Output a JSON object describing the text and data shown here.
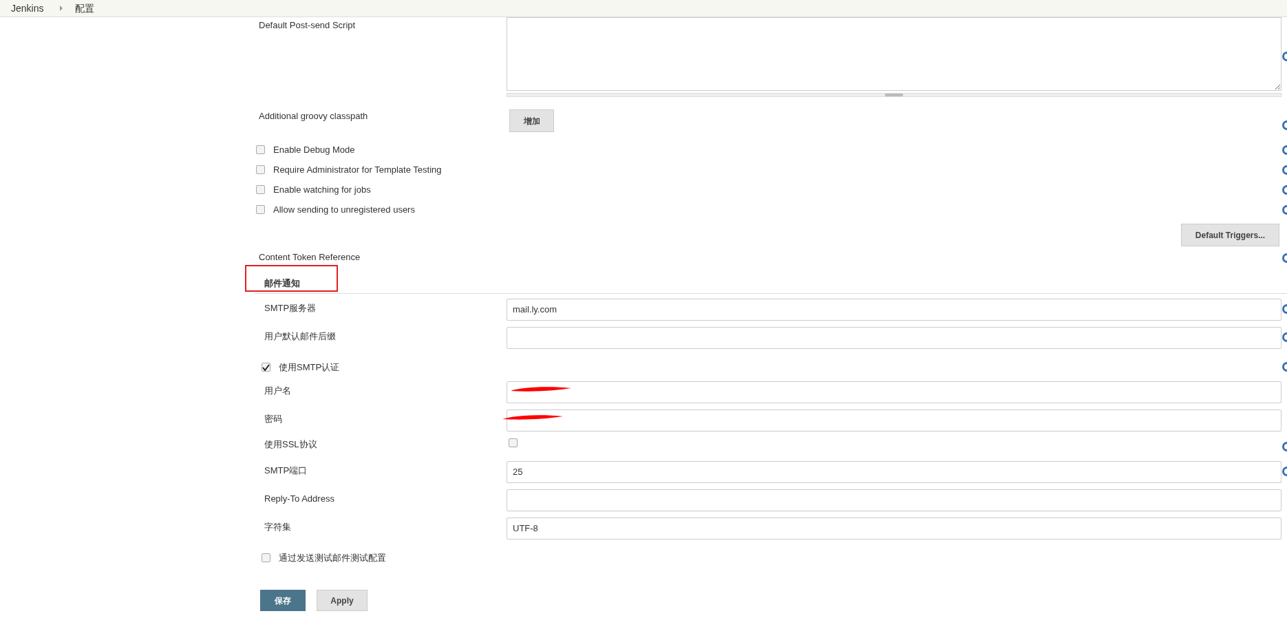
{
  "breadcrumbs": [
    {
      "label": "Jenkins"
    },
    {
      "label": "配置"
    }
  ],
  "rows": [
    {
      "kind": "textarea",
      "label": "Default Post-send Script",
      "help": true
    },
    {
      "kind": "button",
      "label": "Additional groovy classpath",
      "button": "增加",
      "help": true
    },
    {
      "kind": "checkbox",
      "label": "Enable Debug Mode",
      "checked": false,
      "help": true
    },
    {
      "kind": "checkbox",
      "label": "Require Administrator for Template Testing",
      "checked": false,
      "help": true
    },
    {
      "kind": "checkbox",
      "label": "Enable watching for jobs",
      "checked": false,
      "help": true
    },
    {
      "kind": "checkbox",
      "label": "Allow sending to unregistered users",
      "checked": false,
      "help": true
    },
    {
      "kind": "right_button",
      "button": "Default Triggers..."
    },
    {
      "kind": "text",
      "label": "Content Token Reference",
      "help": true
    }
  ],
  "section": {
    "title": "邮件通知",
    "highlighted": true
  },
  "mail_rows": [
    {
      "kind": "field",
      "label": "SMTP服务器",
      "value": "mail.ly.com",
      "help": true
    },
    {
      "kind": "field",
      "label": "用户默认邮件后缀",
      "help": true
    },
    {
      "kind": "checkbox",
      "label": "使用SMTP认证",
      "checked": true,
      "help": true
    },
    {
      "kind": "field",
      "label": "用户名",
      "redacted": true
    },
    {
      "kind": "field",
      "label": "密码",
      "redacted": true
    },
    {
      "kind": "check_field",
      "label": "使用SSL协议",
      "checked": false,
      "help": true
    },
    {
      "kind": "field",
      "label": "SMTP端口",
      "value": "25",
      "help": true
    },
    {
      "kind": "field",
      "label": "Reply-To Address"
    },
    {
      "kind": "field",
      "label": "字符集",
      "value": "UTF-8"
    },
    {
      "kind": "checkbox",
      "label": "通过发送测试邮件测试配置",
      "checked": false
    }
  ],
  "buttons": [
    {
      "label": "保存",
      "kind": "primary"
    },
    {
      "label": "Apply",
      "kind": "secondary"
    }
  ]
}
